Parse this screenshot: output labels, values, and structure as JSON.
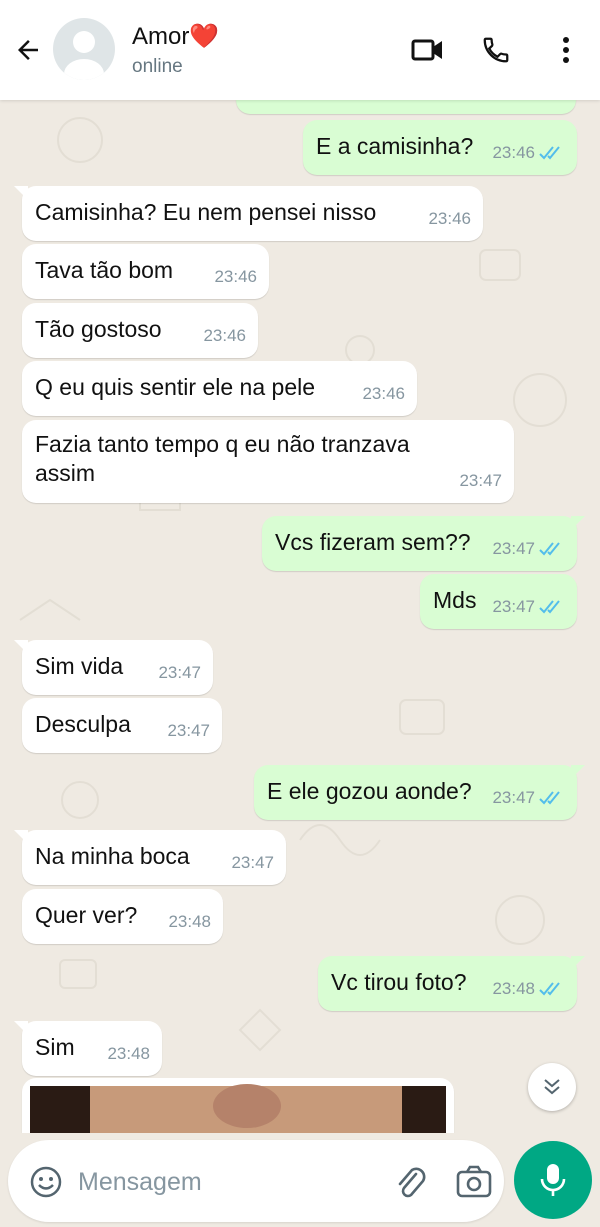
{
  "header": {
    "contact_name": "Amor❤️",
    "status": "online"
  },
  "icons": {
    "back": "arrow-left-icon",
    "video": "video-call-icon",
    "call": "phone-icon",
    "menu": "more-vert-icon",
    "emoji": "emoji-icon",
    "attach": "paperclip-icon",
    "camera": "camera-icon",
    "mic": "microphone-icon",
    "scroll": "chevrons-down-icon"
  },
  "colors": {
    "incoming_bubble": "#ffffff",
    "outgoing_bubble": "#d9fdd3",
    "accent": "#00a884",
    "read_ticks": "#53bdeb"
  },
  "messages": [
    {
      "dir": "out",
      "text": "E a camisinha?",
      "time": "23:46"
    },
    {
      "dir": "in",
      "text": "Camisinha? Eu nem pensei nisso",
      "time": "23:46"
    },
    {
      "dir": "in",
      "text": "Tava tão bom",
      "time": "23:46"
    },
    {
      "dir": "in",
      "text": "Tão gostoso",
      "time": "23:46"
    },
    {
      "dir": "in",
      "text": "Q eu quis sentir ele na pele",
      "time": "23:46"
    },
    {
      "dir": "in",
      "text": "Fazia tanto tempo q eu não tranzava assim",
      "time": "23:47"
    },
    {
      "dir": "out",
      "text": "Vcs fizeram sem??",
      "time": "23:47"
    },
    {
      "dir": "out",
      "text": "Mds",
      "time": "23:47"
    },
    {
      "dir": "in",
      "text": "Sim vida",
      "time": "23:47"
    },
    {
      "dir": "in",
      "text": "Desculpa",
      "time": "23:47"
    },
    {
      "dir": "out",
      "text": "E ele gozou aonde?",
      "time": "23:47"
    },
    {
      "dir": "in",
      "text": "Na minha boca",
      "time": "23:47"
    },
    {
      "dir": "in",
      "text": "Quer ver?",
      "time": "23:48"
    },
    {
      "dir": "out",
      "text": "Vc tirou foto?",
      "time": "23:48"
    },
    {
      "dir": "in",
      "text": "Sim",
      "time": "23:48"
    }
  ],
  "input": {
    "placeholder": "Mensagem",
    "value": ""
  }
}
